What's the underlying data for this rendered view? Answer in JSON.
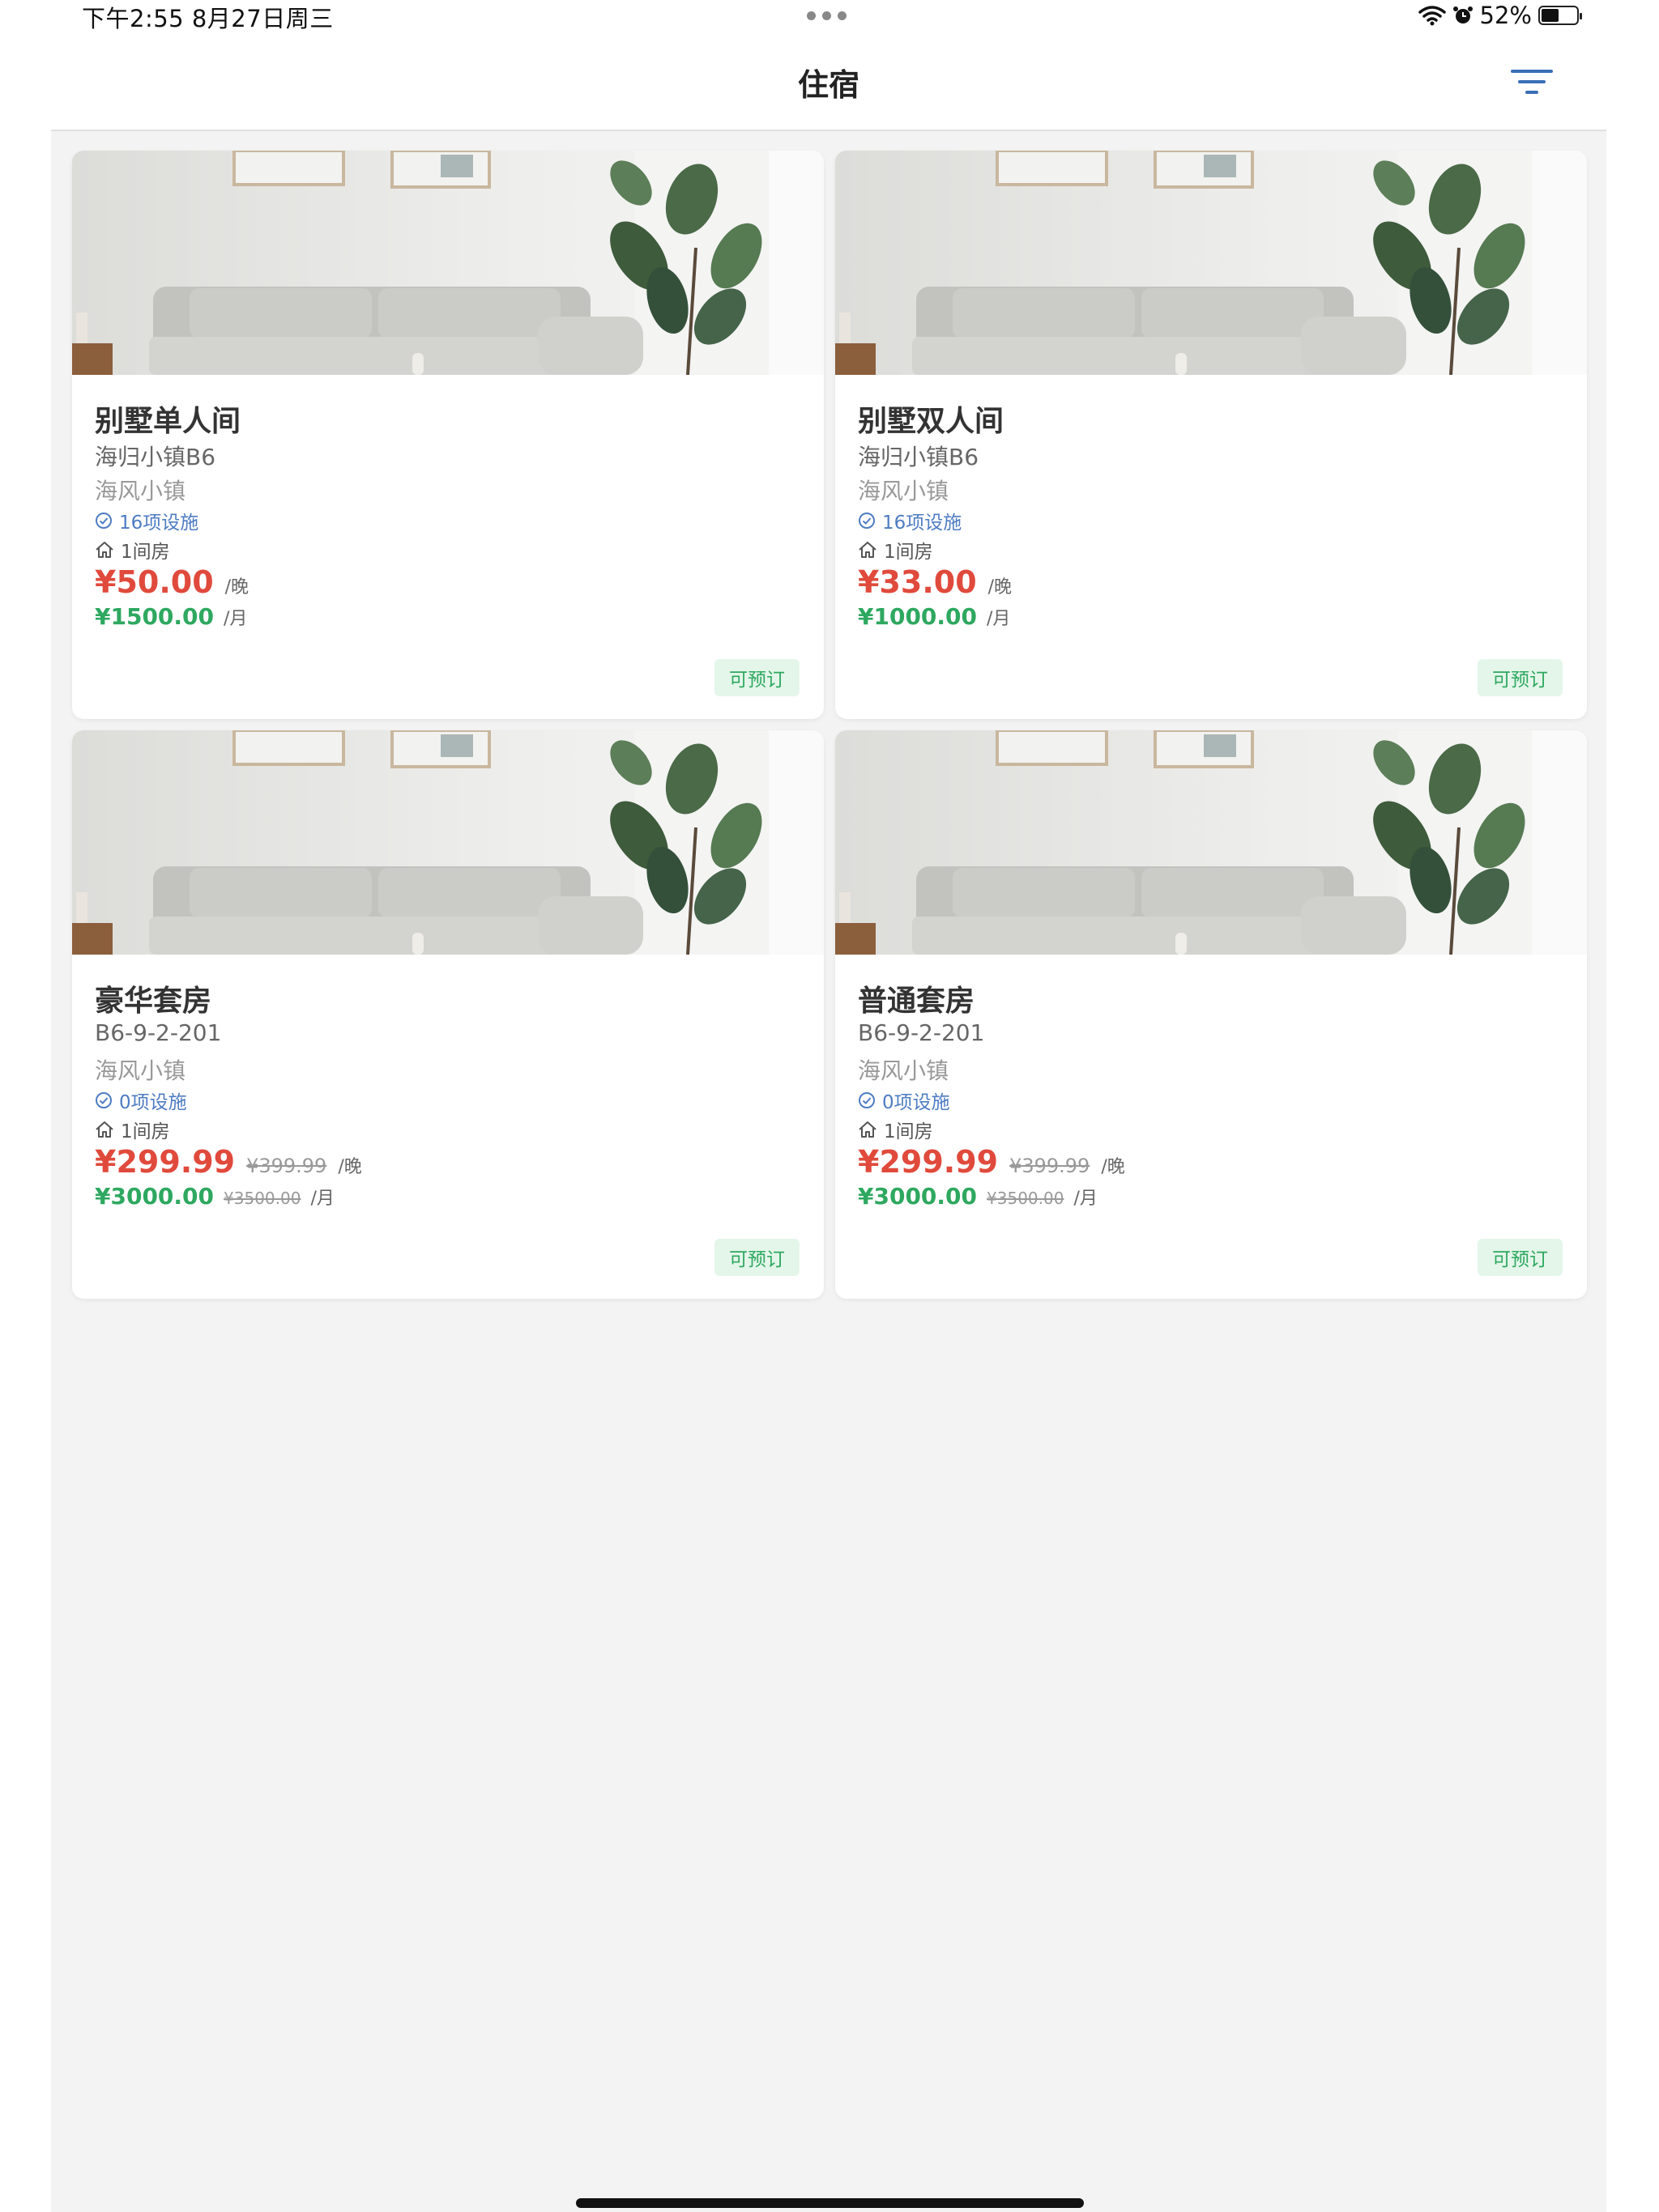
{
  "status_bar": {
    "time": "下午2:55   8月27日周三",
    "battery_percent": "52%",
    "battery_level": 0.52
  },
  "header": {
    "title": "住宿"
  },
  "rooms": [
    {
      "name": "别墅单人间",
      "address": "海归小镇B6",
      "community": "海风小镇",
      "facilities": "16项设施",
      "rooms": "1间房",
      "night_price": "¥50.00",
      "night_original": "",
      "night_unit": "/晚",
      "month_price": "¥1500.00",
      "month_original": "",
      "month_unit": "/月",
      "status": "可预订"
    },
    {
      "name": "别墅双人间",
      "address": "海归小镇B6",
      "community": "海风小镇",
      "facilities": "16项设施",
      "rooms": "1间房",
      "night_price": "¥33.00",
      "night_original": "",
      "night_unit": "/晚",
      "month_price": "¥1000.00",
      "month_original": "",
      "month_unit": "/月",
      "status": "可预订"
    },
    {
      "name": "豪华套房",
      "address": "B6-9-2-201",
      "community": "海风小镇",
      "facilities": "0项设施",
      "rooms": "1间房",
      "night_price": "¥299.99",
      "night_original": "¥399.99",
      "night_unit": "/晚",
      "month_price": "¥3000.00",
      "month_original": "¥3500.00",
      "month_unit": "/月",
      "status": "可预订"
    },
    {
      "name": "普通套房",
      "address": "B6-9-2-201",
      "community": "海风小镇",
      "facilities": "0项设施",
      "rooms": "1间房",
      "night_price": "¥299.99",
      "night_original": "¥399.99",
      "night_unit": "/晚",
      "month_price": "¥3000.00",
      "month_original": "¥3500.00",
      "month_unit": "/月",
      "status": "可预订"
    }
  ],
  "colors": {
    "price_red": "#e04a3c",
    "price_green": "#2ea860",
    "facility_blue": "#4e7cc2",
    "accent_blue": "#3b6fb6",
    "page_bg": "#f3f3f3"
  },
  "icons": {
    "filter": "filter-icon",
    "facilities": "check-circle-icon",
    "rooms": "house-icon",
    "wifi": "wifi-icon",
    "alarm": "alarm-icon",
    "battery": "battery-icon",
    "multitask": "more-dots-icon"
  }
}
